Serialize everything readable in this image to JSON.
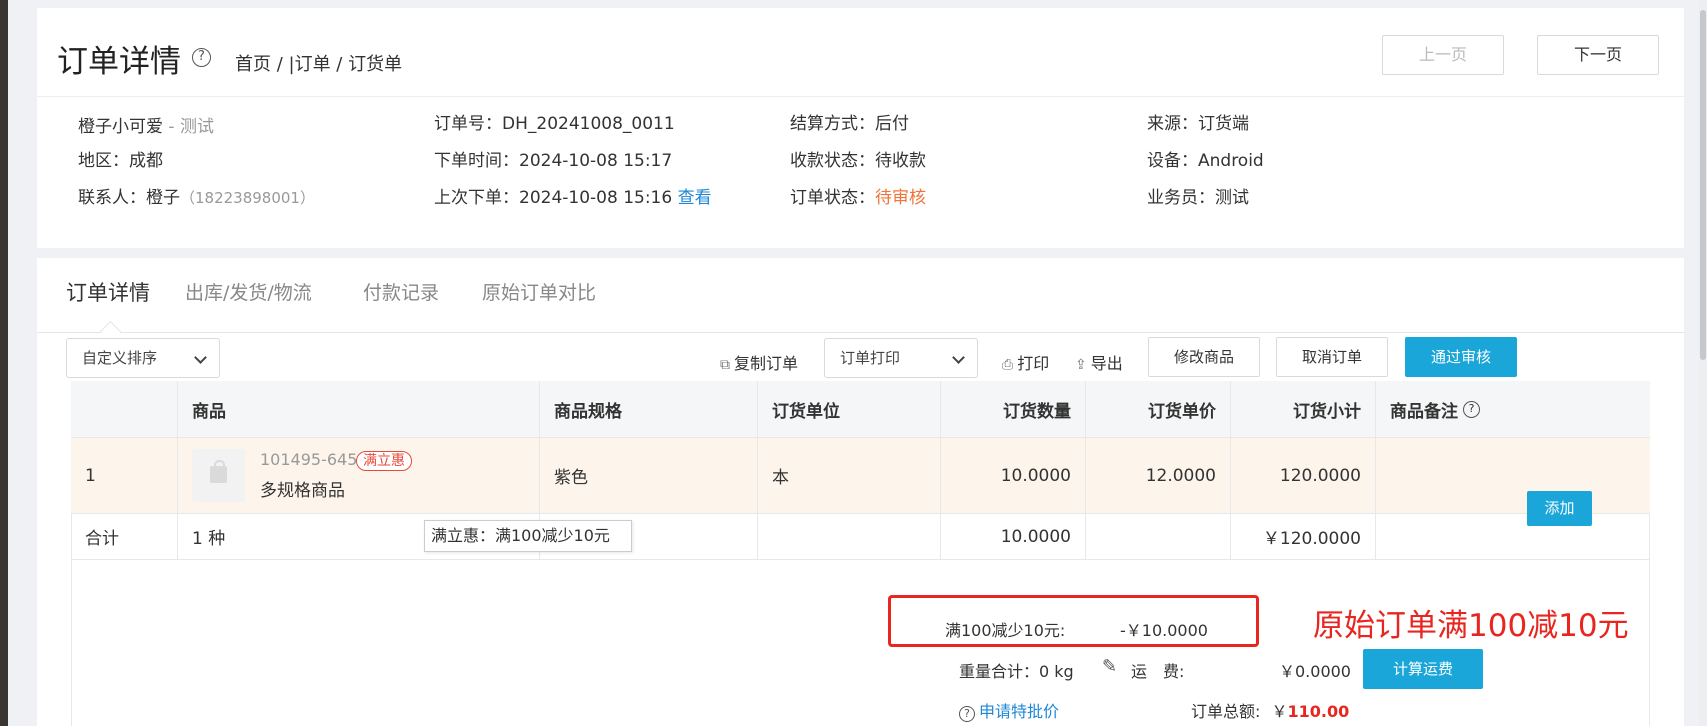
{
  "header": {
    "title": "订单详情",
    "help_symbol": "?",
    "breadcrumb": "首页 / |订单 / 订货单",
    "prev_label": "上一页",
    "next_label": "下一页"
  },
  "info": {
    "customer_name": "橙子小可爱",
    "customer_suffix": " - 测试",
    "region": "地区：成都",
    "contact_label": "联系人：橙子",
    "contact_phone": "（18223898001）",
    "order_no": "订单号：DH_20241008_0011",
    "order_time": "下单时间：2024-10-08 15:17",
    "last_order": "上次下单：2024-10-08 15:16 ",
    "last_order_link": "查看",
    "settlement": "结算方式：后付",
    "payment_status": "收款状态：待收款",
    "order_status_label": "订单状态：",
    "order_status_value": "待审核",
    "source": "来源：订货端",
    "device": "设备：Android",
    "salesperson": "业务员：测试"
  },
  "tabs": [
    {
      "label": "订单详情"
    },
    {
      "label": "出库/发货/物流"
    },
    {
      "label": "付款记录"
    },
    {
      "label": "原始订单对比"
    }
  ],
  "toolbar": {
    "sort_value": "自定义排序",
    "copy_order": "复制订单",
    "print_select": "订单打印",
    "print": "打印",
    "export": "导出",
    "edit_goods": "修改商品",
    "cancel_order": "取消订单",
    "approve": "通过审核"
  },
  "table": {
    "headers": [
      "",
      "商品",
      "商品规格",
      "订货单位",
      "订货数量",
      "订货单价",
      "订货小计",
      "商品备注"
    ],
    "rows": [
      {
        "index": "1",
        "sku": "101495-645",
        "promo": "满立惠",
        "name": "多规格商品",
        "spec": "紫色",
        "unit": "本",
        "qty": "10.0000",
        "price": "12.0000",
        "subtotal": "120.0000",
        "remark_btn": "添加"
      }
    ],
    "total": {
      "label": "合计",
      "kinds": "1 种",
      "qty": "10.0000",
      "subtotal": "￥120.0000"
    },
    "tooltip": "满立惠：满100减少10元"
  },
  "summary": {
    "discount_label": "满100减少10元:",
    "discount_value": "-￥10.0000",
    "annotation": "原始订单满100减10元",
    "weight": "重量合计：0 kg",
    "shipping_label": "运　费:",
    "shipping_value": "￥0.0000",
    "calc_shipping": "计算运费",
    "special_price": "申请特批价",
    "total_label": "订单总额:",
    "total_currency": "￥",
    "total_value": "110.00"
  },
  "colors": {
    "primary": "#1aa6d9",
    "status_orange": "#f0733a",
    "link_blue": "#1e88d6",
    "annotation_red": "#e8261f"
  }
}
